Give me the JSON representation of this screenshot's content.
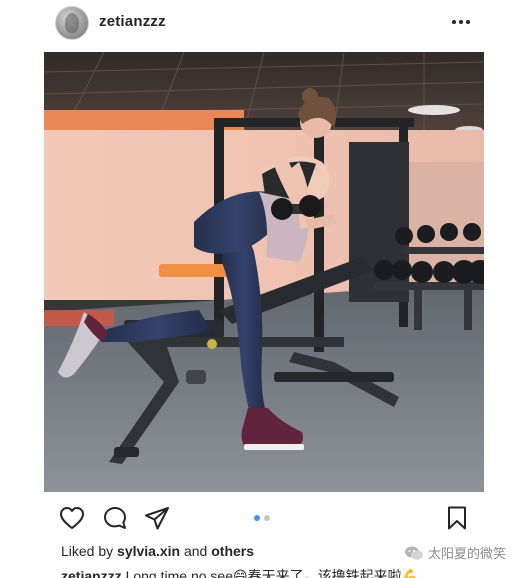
{
  "post": {
    "username": "zetianzzz",
    "likes_prefix": "Liked by",
    "liked_by_user": "sylvia.xin",
    "likes_conjunction": "and",
    "likes_others": "others",
    "caption_user": "zetianzzz",
    "caption_text": "Long time no see😄春天来了，该撸铁起来啦💪",
    "carousel": {
      "count": 2,
      "active_index": 0
    }
  },
  "icons": {
    "more": "more-horizontal-icon",
    "like": "heart-icon",
    "comment": "comment-icon",
    "share": "paper-plane-icon",
    "save": "bookmark-icon"
  },
  "watermark": {
    "text": "太阳夏的微笑"
  },
  "colors": {
    "text": "#262626",
    "accent": "#3897f0",
    "dot_inactive": "#c7c7c7",
    "watermark": "#8c8c8c"
  }
}
